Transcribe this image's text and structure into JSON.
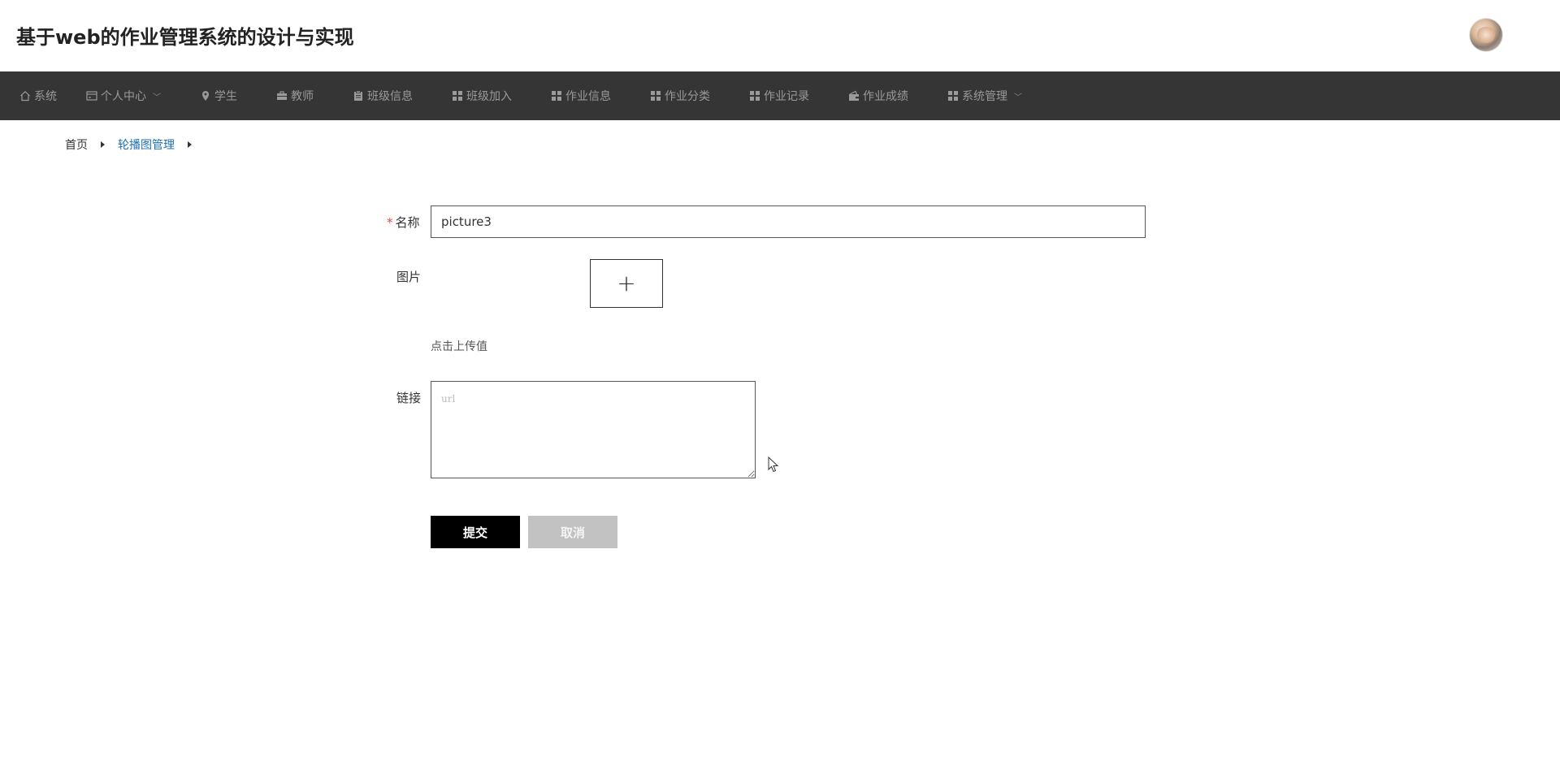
{
  "header": {
    "title": "基于web的作业管理系统的设计与实现"
  },
  "nav": {
    "items": [
      {
        "label": "系统",
        "icon": "home-icon",
        "dropdown": false
      },
      {
        "label": "个人中心",
        "icon": "card-icon",
        "dropdown": true
      },
      {
        "label": "学生",
        "icon": "location-pin-icon",
        "dropdown": false
      },
      {
        "label": "教师",
        "icon": "briefcase-icon",
        "dropdown": false
      },
      {
        "label": "班级信息",
        "icon": "clipboard-icon",
        "dropdown": false
      },
      {
        "label": "班级加入",
        "icon": "grid-icon",
        "dropdown": false
      },
      {
        "label": "作业信息",
        "icon": "grid-icon",
        "dropdown": false
      },
      {
        "label": "作业分类",
        "icon": "grid-icon",
        "dropdown": false
      },
      {
        "label": "作业记录",
        "icon": "grid-icon",
        "dropdown": false
      },
      {
        "label": "作业成绩",
        "icon": "wallet-icon",
        "dropdown": false
      },
      {
        "label": "系统管理",
        "icon": "grid-icon",
        "dropdown": true
      }
    ]
  },
  "breadcrumb": {
    "home": "首页",
    "current": "轮播图管理"
  },
  "form": {
    "name_required_mark": "*",
    "name_label": "名称",
    "name_value": "picture3",
    "image_label": "图片",
    "upload_plus": "+",
    "upload_hint": "点击上传值",
    "link_label": "链接",
    "link_placeholder": "url",
    "submit_label": "提交",
    "cancel_label": "取消"
  },
  "colors": {
    "nav_bg": "#353535",
    "nav_text": "#9a9a9a",
    "breadcrumb_active": "#1e6fb0",
    "submit_bg": "#000000",
    "cancel_bg": "#c2c2c2",
    "required": "#e0473d"
  }
}
